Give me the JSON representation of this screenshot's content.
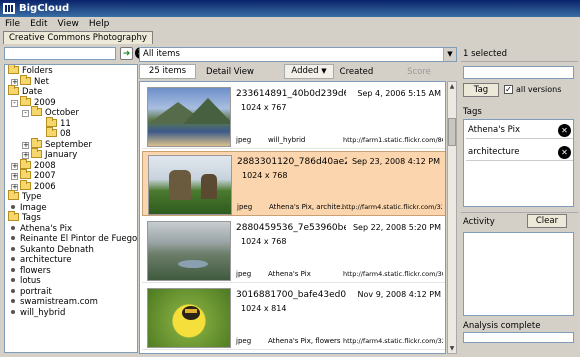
{
  "app": {
    "title": "BigCloud"
  },
  "menu": [
    "File",
    "Edit",
    "View",
    "Help"
  ],
  "tabs": [
    {
      "label": "Creative Commons Photography"
    }
  ],
  "tree": [
    {
      "label": "Folders",
      "icon": "folder-icon",
      "kind": "folder",
      "depth": 0,
      "exp": ""
    },
    {
      "label": "Net",
      "icon": "folder-icon",
      "kind": "folder",
      "depth": 1,
      "exp": "+"
    },
    {
      "label": "Date",
      "icon": "folder-icon",
      "kind": "folder",
      "depth": 0,
      "exp": ""
    },
    {
      "label": "2009",
      "icon": "folder-icon",
      "kind": "folder",
      "depth": 1,
      "exp": "-"
    },
    {
      "label": "October",
      "icon": "folder-icon",
      "kind": "folder",
      "depth": 2,
      "exp": "-"
    },
    {
      "label": "11",
      "icon": "folder-icon",
      "kind": "folder",
      "depth": 3,
      "exp": ""
    },
    {
      "label": "08",
      "icon": "folder-icon",
      "kind": "folder",
      "depth": 3,
      "exp": ""
    },
    {
      "label": "September",
      "icon": "folder-icon",
      "kind": "folder",
      "depth": 2,
      "exp": "+"
    },
    {
      "label": "January",
      "icon": "folder-icon",
      "kind": "folder",
      "depth": 2,
      "exp": "+"
    },
    {
      "label": "2008",
      "icon": "folder-icon",
      "kind": "folder",
      "depth": 1,
      "exp": "+"
    },
    {
      "label": "2007",
      "icon": "folder-icon",
      "kind": "folder",
      "depth": 1,
      "exp": "+"
    },
    {
      "label": "2006",
      "icon": "folder-icon",
      "kind": "folder",
      "depth": 1,
      "exp": "+"
    },
    {
      "label": "Type",
      "icon": "folder-icon",
      "kind": "folder",
      "depth": 0,
      "exp": ""
    },
    {
      "label": "Image",
      "icon": "bullet-icon",
      "kind": "leaf",
      "depth": 1,
      "exp": ""
    },
    {
      "label": "Tags",
      "icon": "folder-icon",
      "kind": "folder",
      "depth": 0,
      "exp": ""
    },
    {
      "label": "Athena's Pix",
      "icon": "bullet-icon",
      "kind": "leaf",
      "depth": 1,
      "exp": ""
    },
    {
      "label": "Reinante El Pintor de Fuego",
      "icon": "bullet-icon",
      "kind": "leaf",
      "depth": 1,
      "exp": ""
    },
    {
      "label": "Sukanto Debnath",
      "icon": "bullet-icon",
      "kind": "leaf",
      "depth": 1,
      "exp": ""
    },
    {
      "label": "architecture",
      "icon": "bullet-icon",
      "kind": "leaf",
      "depth": 1,
      "exp": ""
    },
    {
      "label": "flowers",
      "icon": "bullet-icon",
      "kind": "leaf",
      "depth": 1,
      "exp": ""
    },
    {
      "label": "lotus",
      "icon": "bullet-icon",
      "kind": "leaf",
      "depth": 1,
      "exp": ""
    },
    {
      "label": "portrait",
      "icon": "bullet-icon",
      "kind": "leaf",
      "depth": 1,
      "exp": ""
    },
    {
      "label": "swamistream.com",
      "icon": "bullet-icon",
      "kind": "leaf",
      "depth": 1,
      "exp": ""
    },
    {
      "label": "will_hybrid",
      "icon": "bullet-icon",
      "kind": "leaf",
      "depth": 1,
      "exp": ""
    }
  ],
  "filter": {
    "value": "All items"
  },
  "sortbar": {
    "count": "25 items",
    "view": "Detail View",
    "added": "Added",
    "created": "Created",
    "score": "Score"
  },
  "items": [
    {
      "name": "233614891_40b0d239d6...",
      "date": "Sep 4, 2006 5:15 AM",
      "dims": "1024 x 767",
      "type": "jpeg",
      "tags": "will_hybrid",
      "url": "http://farm1.static.flickr.com/86/233...",
      "thumb": "mountains"
    },
    {
      "name": "2883301120_786d40ae2...",
      "date": "Sep 23, 2008 4:12 PM",
      "dims": "1024 x 768",
      "type": "jpeg",
      "tags": "Athena's Pix, archite...",
      "url": "http://farm4.static.flickr.com/3204/2...",
      "thumb": "castle"
    },
    {
      "name": "2880459536_7e53960be...",
      "date": "Sep 22, 2008 5:20 PM",
      "dims": "1024 x 768",
      "type": "jpeg",
      "tags": "Athena's Pix",
      "url": "http://farm4.static.flickr.com/3047/2...",
      "thumb": "valley"
    },
    {
      "name": "3016881700_bafe43ed0...",
      "date": "Nov 9, 2008 4:12 PM",
      "dims": "1024 x 814",
      "type": "jpeg",
      "tags": "Athena's Pix, flowers",
      "url": "http://farm4.static.flickr.com/3202/3...",
      "thumb": "bee"
    }
  ],
  "right": {
    "selected": "1 selected",
    "tag_button": "Tag",
    "all_versions": "all versions",
    "tags_heading": "Tags",
    "tags": [
      "Athena's Pix",
      "architecture"
    ],
    "activity_heading": "Activity",
    "clear_button": "Clear",
    "status": "Analysis complete"
  }
}
